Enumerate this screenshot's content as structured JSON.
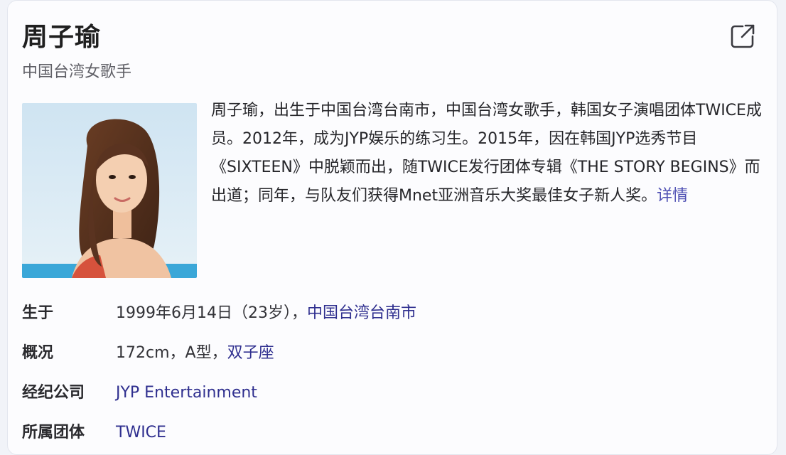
{
  "header": {
    "name": "周子瑜",
    "subtitle": "中国台湾女歌手",
    "share_icon": "external-link-icon"
  },
  "summary": {
    "text": "周子瑜，出生于中国台湾台南市，中国台湾女歌手，韩国女子演唱团体TWICE成员。2012年，成为JYP娱乐的练习生。2015年，因在韩国JYP选秀节目《SIXTEEN》中脱颖而出，随TWICE发行团体专辑《THE STORY BEGINS》而出道；同年，与队友们获得Mnet亚洲音乐大奖最佳女子新人奖。",
    "more_link": "详情"
  },
  "info": {
    "born": {
      "label": "生于",
      "date": "1999年6月14日（23岁），",
      "place_link": "中国台湾台南市"
    },
    "overview": {
      "label": "概况",
      "text": "172cm，A型，",
      "zodiac_link": "双子座"
    },
    "agency": {
      "label": "经纪公司",
      "link": "JYP Entertainment"
    },
    "group": {
      "label": "所属团体",
      "link": "TWICE"
    }
  },
  "colors": {
    "link": "#2f2f8f",
    "more_link": "#4e4fb3",
    "card_background": "#fcfcfe"
  }
}
